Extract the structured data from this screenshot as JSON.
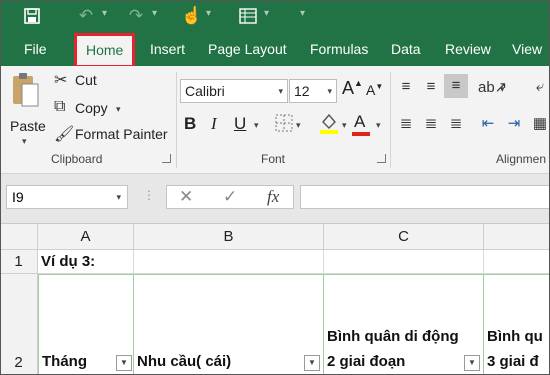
{
  "quick_access": {
    "save_icon": "save-icon",
    "undo_icon": "undo-icon",
    "redo_icon": "redo-icon",
    "touch_icon": "touch-mode-icon",
    "form_icon": "form-icon",
    "customize_icon": "customize-toolbar-icon"
  },
  "tabs": [
    "File",
    "Home",
    "Insert",
    "Page Layout",
    "Formulas",
    "Data",
    "Review",
    "View"
  ],
  "active_tab": "Home",
  "highlight_color": "#e8232e",
  "accent_color": "#217346",
  "clipboard": {
    "paste_label": "Paste",
    "cut_label": "Cut",
    "copy_label": "Copy",
    "format_painter_label": "Format Painter",
    "group_label": "Clipboard"
  },
  "font": {
    "font_name": "Calibri",
    "font_size": "12",
    "bold": "B",
    "italic": "I",
    "underline": "U",
    "font_color_letter": "A",
    "group_label": "Font"
  },
  "alignment": {
    "group_label": "Alignmen"
  },
  "formula_bar": {
    "name_box": "I9",
    "cancel_icon": "✕",
    "enter_icon": "✓",
    "fx_label": "fx",
    "formula": ""
  },
  "sheet": {
    "columns": [
      "A",
      "B",
      "C",
      ""
    ],
    "rows": [
      "1",
      "2"
    ],
    "cells": {
      "A1": "Ví dụ 3:",
      "A2": "Tháng",
      "B2": "Nhu cầu( cái)",
      "C2_line1": "Bình quân di động",
      "C2_line2": "2 giai đoạn",
      "D2_line1": "Bình qu",
      "D2_line2": "3 giai đ"
    }
  }
}
